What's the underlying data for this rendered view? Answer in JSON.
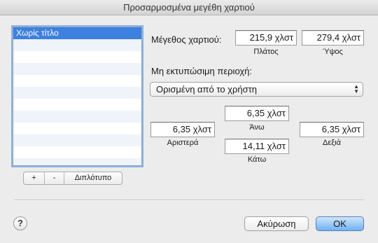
{
  "window": {
    "title": "Προσαρμοσμένα μεγέθη χαρτιού"
  },
  "list": {
    "items": [
      "Χωρίς τίτλο"
    ]
  },
  "list_controls": {
    "add": "+",
    "remove": "-",
    "duplicate": "Διπλότυπο"
  },
  "paper_size": {
    "label": "Μέγεθος χαρτιού:",
    "width_value": "215,9 χλστ",
    "width_label": "Πλάτος",
    "height_value": "279,4 χλστ",
    "height_label": "Ύψος"
  },
  "margins": {
    "label": "Μη εκτυπώσιμη περιοχή:",
    "source": "Ορισμένη από το χρήστη",
    "top_value": "6,35 χλστ",
    "top_label": "Άνω",
    "left_value": "6,35 χλστ",
    "left_label": "Αριστερά",
    "right_value": "6,35 χλστ",
    "right_label": "Δεξιά",
    "bottom_value": "14,11 χλστ",
    "bottom_label": "Κάτω"
  },
  "footer": {
    "help": "?",
    "cancel": "Ακύρωση",
    "ok": "OK"
  }
}
